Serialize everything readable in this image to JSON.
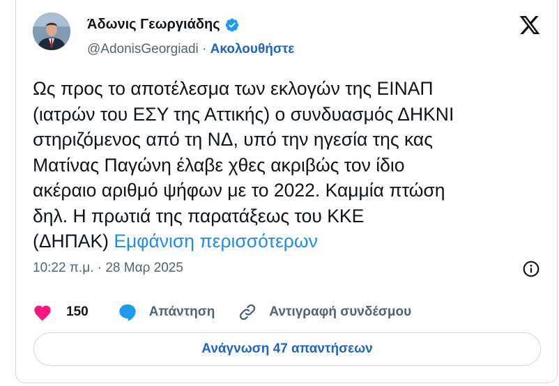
{
  "author": {
    "name": "Άδωνις Γεωργιάδης",
    "handle": "@AdonisGeorgiadi",
    "separator": "·",
    "follow_label": "Ακολουθήστε",
    "verified": true
  },
  "tweet": {
    "text": "Ως προς το αποτέλεσμα των εκλογών της ΕΙΝΑΠ\n(ιατρών του ΕΣΥ της Αττικής) ο συνδυασμός ΔΗΚΝΙ\nστηριζόμενος από τη ΝΔ, υπό την ηγεσία της κας\nΜατίνας Παγώνη έλαβε χθες ακριβώς τον ίδιο\nακέραιο αριθμό ψήφων με το 2022. Καμμία πτώση\nδηλ. Η πρωτιά της παρατάξεως του ΚΚΕ\n(ΔΗΠΑΚ) ",
    "show_more_label": "Εμφάνιση περισσότερων",
    "time": "10:22 π.μ.",
    "date_separator": "·",
    "date": "28 Μαρ 2025"
  },
  "actions": {
    "like_count": "150",
    "reply_label": "Απάντηση",
    "copy_link_label": "Αντιγραφή συνδέσμου"
  },
  "read_replies_label": "Ανάγνωση 47 απαντήσεων",
  "icons": {
    "verified": "verified-badge-icon",
    "x_logo": "x-logo-icon",
    "info": "info-icon",
    "like": "heart-icon",
    "reply": "speech-bubble-icon",
    "copy_link": "link-icon"
  },
  "colors": {
    "text": "#0f1419",
    "secondary": "#536471",
    "link": "#1d8bf0",
    "follow": "#1d64c8",
    "like": "#f91880",
    "verified": "#1d9bf0",
    "border": "#cfd9de"
  }
}
